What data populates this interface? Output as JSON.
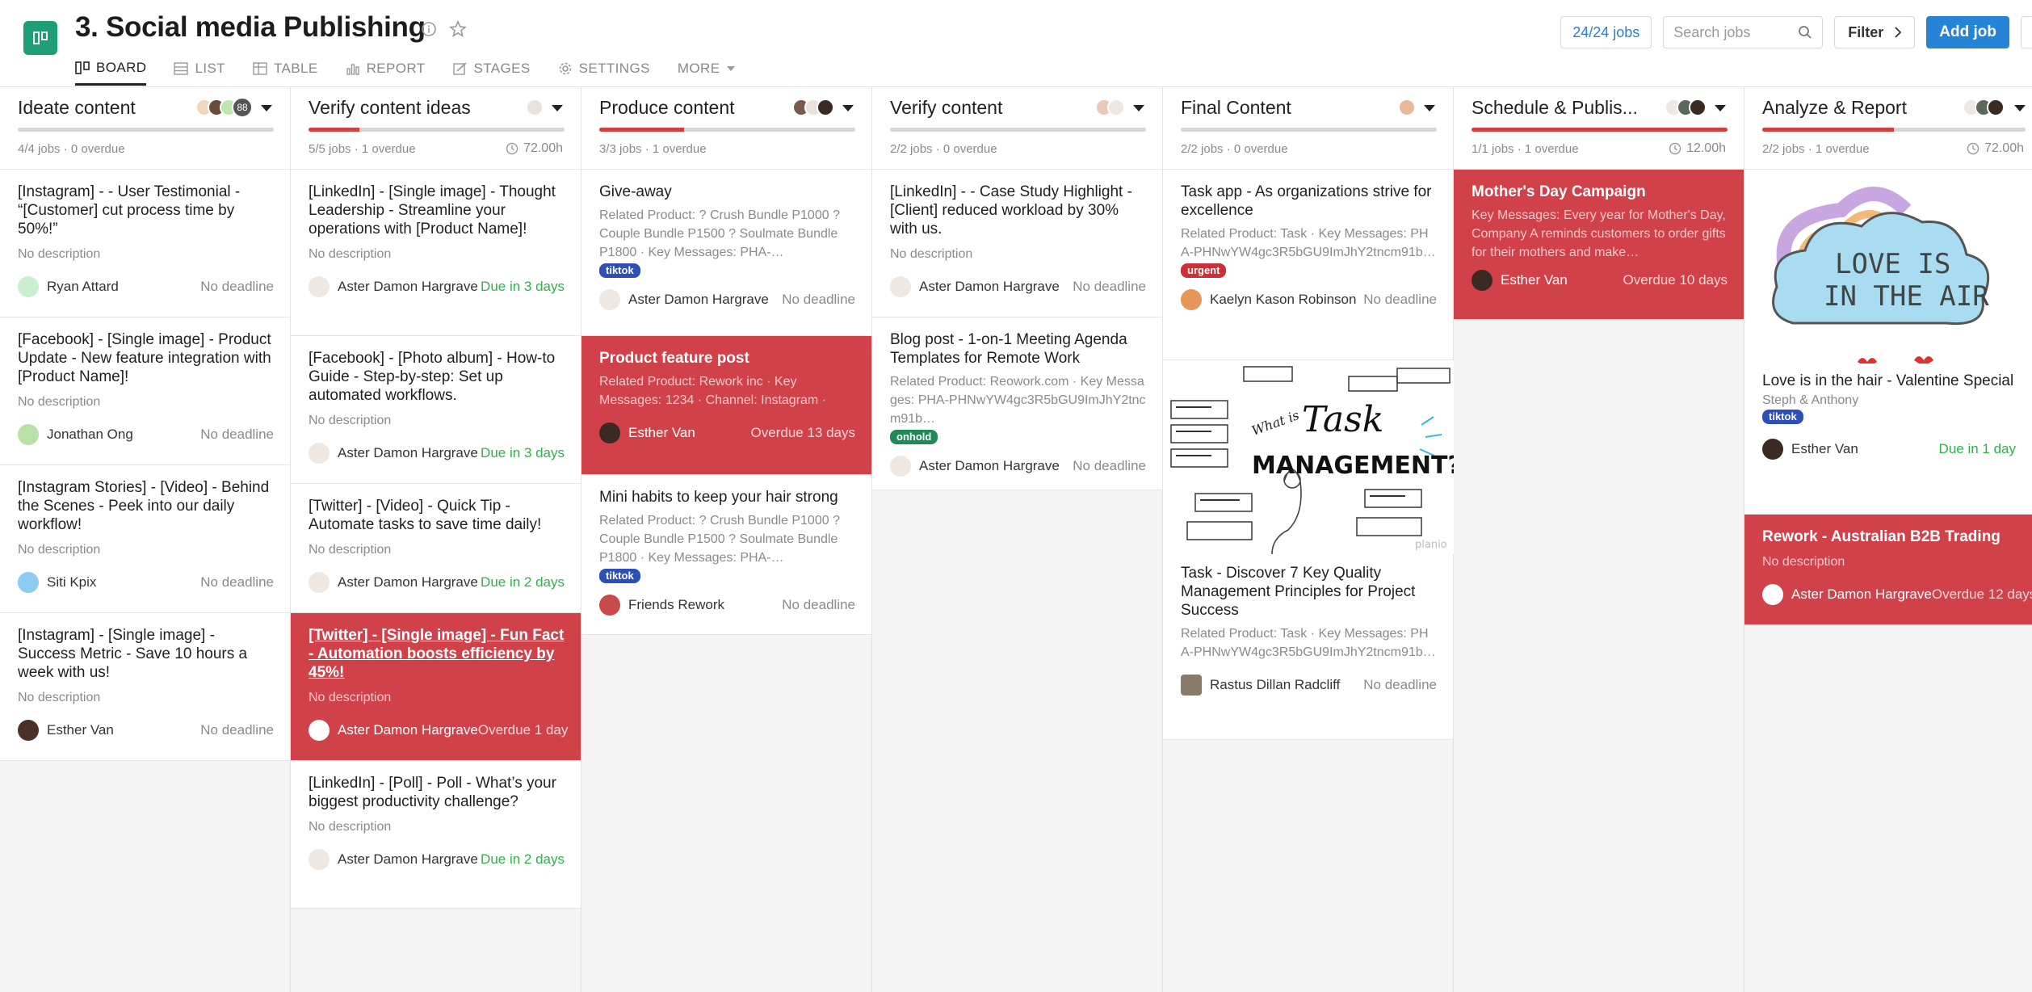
{
  "header": {
    "title": "3. Social media Publishing",
    "tabs": [
      {
        "label": "BOARD",
        "icon": "board-icon",
        "active": true
      },
      {
        "label": "LIST",
        "icon": "list-icon"
      },
      {
        "label": "TABLE",
        "icon": "table-icon"
      },
      {
        "label": "REPORT",
        "icon": "report-icon"
      },
      {
        "label": "STAGES",
        "icon": "stages-icon"
      },
      {
        "label": "SETTINGS",
        "icon": "gear-icon"
      },
      {
        "label": "MORE",
        "icon": "caret-down-icon"
      }
    ],
    "jobs_count": "24/24 jobs",
    "search_placeholder": "Search jobs",
    "filter_label": "Filter",
    "add_label": "Add job"
  },
  "colors": {
    "accent": "#2684d6",
    "brand": "#1f9d74",
    "overdue": "#d0414a",
    "due_soon": "#2fb24c"
  },
  "columns": [
    {
      "title": "Ideate content",
      "meta": "4/4 jobs · 0 overdue",
      "avatar_count": "88",
      "progress": 0,
      "cards": [
        {
          "title": "[Instagram] - - User Testimonial - “[Customer] cut process time by 50%!”",
          "desc": "No description",
          "assignee": "Ryan Attard",
          "when": "No deadline"
        },
        {
          "title": "[Facebook] - [Single image] - Product Update - New feature integration with [Product Name]!",
          "desc": "No description",
          "assignee": "Jonathan Ong",
          "when": "No deadline"
        },
        {
          "title": "[Instagram Stories] - [Video] - Behind the Scenes - Peek into our daily workflow!",
          "desc": "No description",
          "assignee": "Siti Kpix",
          "when": "No deadline"
        },
        {
          "title": "[Instagram] - [Single image] - Success Metric - Save 10 hours a week with us!",
          "desc": "No description",
          "assignee": "Esther Van",
          "when": "No deadline"
        }
      ]
    },
    {
      "title": "Verify content ideas",
      "meta": "5/5 jobs · 1 overdue",
      "hours": "72.00h",
      "progress": 0.2,
      "cards": [
        {
          "title": "[LinkedIn] - [Single image] - Thought Leadership - Streamline your operations with [Product Name]!",
          "desc": "No description",
          "assignee": "Aster Damon Hargrave",
          "when": "Due in 3 days"
        },
        {
          "title": "[Facebook] - [Photo album] - How-to Guide - Step-by-step: Set up automated workflows.",
          "desc": "No description",
          "assignee": "Aster Damon Hargrave",
          "when": "Due in 3 days"
        },
        {
          "title": "[Twitter] - [Video] - Quick Tip - Automate tasks to save time daily!",
          "desc": "No description",
          "assignee": "Aster Damon Hargrave",
          "when": "Due in 2 days"
        },
        {
          "title": "[Twitter] - [Single image] - Fun Fact - Automation boosts efficiency by 45%!",
          "desc": "No description",
          "assignee": "Aster Damon Hargrave",
          "when": "Overdue 1 day"
        },
        {
          "title": "[LinkedIn] - [Poll] - Poll - What’s your biggest productivity challenge?",
          "desc": "No description",
          "assignee": "Aster Damon Hargrave",
          "when": "Due in 2 days"
        }
      ]
    },
    {
      "title": "Produce content",
      "meta": "3/3 jobs · 1 overdue",
      "progress": 0.33,
      "cards": [
        {
          "title": "Give-away",
          "desc": "Related Product: ? Crush Bundle P1000 ? Couple Bundle P1500 ? Soulmate Bundle P1800 · Key Messages: PHA-…",
          "tag": "tiktok",
          "assignee": "Aster Damon Hargrave",
          "when": "No deadline"
        },
        {
          "title": "Product feature post",
          "desc": "Related Product: Rework inc · Key Messages: 1234 · Channel: Instagram ·",
          "assignee": "Esther Van",
          "when": "Overdue 13 days"
        },
        {
          "title": "Mini habits to keep your hair strong",
          "desc": "Related Product: ? Crush Bundle P1000 ? Couple Bundle P1500 ? Soulmate Bundle P1800 · Key Messages: PHA-…",
          "tag": "tiktok",
          "assignee": "Friends Rework",
          "when": "No deadline"
        }
      ]
    },
    {
      "title": "Verify content",
      "meta": "2/2 jobs · 0 overdue",
      "progress": 0,
      "cards": [
        {
          "title": "[LinkedIn] - - Case Study Highlight - [Client] reduced workload by 30% with us.",
          "desc": "No description",
          "assignee": "Aster Damon Hargrave",
          "when": "No deadline"
        },
        {
          "title": "Blog post - 1-on-1 Meeting Agenda Templates for Remote Work",
          "desc": "Related Product: Reowork.com · Key Messages: PHA-PHNwYW4gc3R5bGU9ImJhY2tncm91b…",
          "tag": "onhold",
          "assignee": "Aster Damon Hargrave",
          "when": "No deadline"
        }
      ]
    },
    {
      "title": "Final Content",
      "meta": "2/2 jobs · 0 overdue",
      "progress": 0,
      "cards": [
        {
          "title": "Task app - As organizations strive for excellence",
          "desc": "Related Product: Task · Key Messages: PHA-PHNwYW4gc3R5bGU9ImJhY2tncm91b…",
          "tag": "urgent",
          "assignee": "Kaelyn Kason Robinson",
          "when": "No deadline"
        },
        {
          "image_words": [
            "What is",
            "Task",
            "MANAGEMENT?"
          ],
          "image_credit": "planio",
          "title": "Task - Discover 7 Key Quality Management Principles for Project Success",
          "desc": "Related Product: Task · Key Messages: PHA-PHNwYW4gc3R5bGU9ImJhY2tncm91b…",
          "assignee": "Rastus Dillan Radcliff",
          "when": "No deadline"
        }
      ]
    },
    {
      "title": "Schedule & Publis...",
      "meta": "1/1 jobs · 1 overdue",
      "hours": "12.00h",
      "progress": 1,
      "cards": [
        {
          "title": "Mother's Day Campaign",
          "desc": "Key Messages: Every year for Mother's Day, Company A reminds customers to order gifts for their mothers and make…",
          "assignee": "Esther Van",
          "when": "Overdue 10 days"
        }
      ]
    },
    {
      "title": "Analyze & Report",
      "meta": "2/2 jobs · 1 overdue",
      "hours": "72.00h",
      "progress": 0.5,
      "cards": [
        {
          "image_words": [
            "LOVE IS",
            "IN THE AIR"
          ],
          "title": "Love is in the hair - Valentine Special",
          "sub": "Steph & Anthony",
          "tag": "tiktok",
          "assignee": "Esther Van",
          "when": "Due in 1 day"
        },
        {
          "title": "Rework - Australian B2B Trading",
          "desc": "No description",
          "assignee": "Aster Damon Hargrave",
          "when": "Overdue 12 days"
        }
      ]
    }
  ]
}
